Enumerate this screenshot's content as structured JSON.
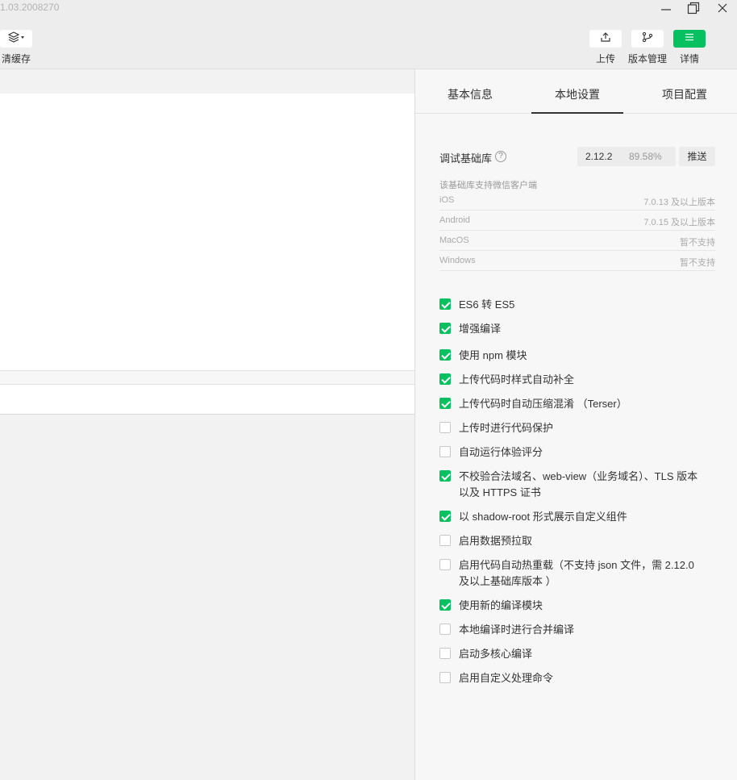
{
  "window": {
    "version": "1.03.2008270"
  },
  "toolbar": {
    "clear_cache_label": "清缓存",
    "upload_label": "上传",
    "version_mgmt_label": "版本管理",
    "details_label": "详情"
  },
  "panel": {
    "tabs": [
      {
        "label": "基本信息"
      },
      {
        "label": "本地设置"
      },
      {
        "label": "项目配置"
      }
    ],
    "debug_lib": {
      "label": "调试基础库",
      "version": "2.12.2",
      "percent": "89.58%",
      "push_label": "推送"
    },
    "support": {
      "title": "该基础库支持微信客户端",
      "rows": [
        {
          "os": "iOS",
          "ver": "7.0.13 及以上版本"
        },
        {
          "os": "Android",
          "ver": "7.0.15 及以上版本"
        },
        {
          "os": "MacOS",
          "ver": "暂不支持"
        },
        {
          "os": "Windows",
          "ver": "暂不支持"
        }
      ]
    },
    "options": [
      {
        "label": "ES6 转 ES5",
        "checked": true
      },
      {
        "label": "增强编译",
        "checked": true
      },
      {
        "label": "使用 npm 模块",
        "checked": true
      },
      {
        "label": "上传代码时样式自动补全",
        "checked": true
      },
      {
        "label": "上传代码时自动压缩混淆 （Terser）",
        "checked": true
      },
      {
        "label": "上传时进行代码保护",
        "checked": false
      },
      {
        "label": "自动运行体验评分",
        "checked": false
      },
      {
        "label": "不校验合法域名、web-view（业务域名）、TLS 版本以及 HTTPS 证书",
        "checked": true
      },
      {
        "label": "以 shadow-root 形式展示自定义组件",
        "checked": true
      },
      {
        "label": "启用数据预拉取",
        "checked": false
      },
      {
        "label": "启用代码自动热重载（不支持 json 文件，需 2.12.0 及以上基础库版本 ）",
        "checked": false
      },
      {
        "label": "使用新的编译模块",
        "checked": true
      },
      {
        "label": "本地编译时进行合并编译",
        "checked": false
      },
      {
        "label": "启动多核心编译",
        "checked": false
      },
      {
        "label": "启用自定义处理命令",
        "checked": false
      }
    ]
  }
}
